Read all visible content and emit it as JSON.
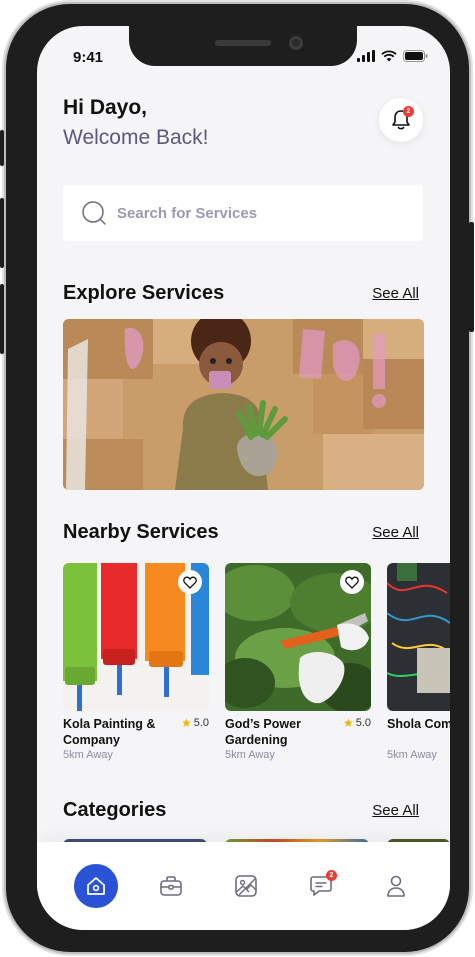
{
  "status_bar": {
    "time": "9:41"
  },
  "header": {
    "greeting": "Hi Dayo,",
    "subtitle": "Welcome Back!",
    "notification_count": "2"
  },
  "search": {
    "placeholder": "Search for Services"
  },
  "sections": {
    "explore": {
      "title": "Explore Services",
      "see_all": "See All"
    },
    "nearby": {
      "title": "Nearby Services",
      "see_all": "See All"
    },
    "categories": {
      "title": "Categories",
      "see_all": "See All"
    }
  },
  "nearby_services": [
    {
      "name": "Kola Painting & Company",
      "rating": "5.0",
      "distance": "5km Away"
    },
    {
      "name": "God’s Power Gardening",
      "rating": "5.0",
      "distance": "5km Away"
    },
    {
      "name": "Shola Computer Repairs",
      "distance": "5km Away"
    }
  ],
  "bottom_nav": {
    "items": [
      "home-icon",
      "briefcase-icon",
      "gallery-icon",
      "chat-icon",
      "profile-icon"
    ],
    "chat_badge": "2"
  },
  "colors": {
    "accent": "#2a52d6",
    "badge": "#ef3b36",
    "subtitle": "#5c5780"
  }
}
